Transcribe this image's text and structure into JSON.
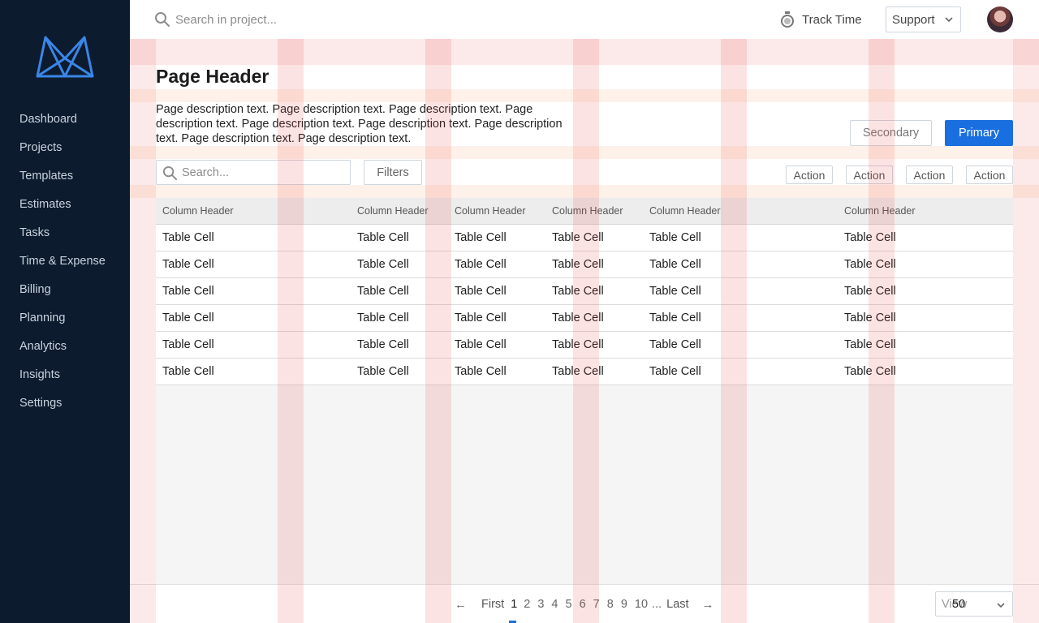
{
  "sidebar": {
    "items": [
      {
        "label": "Dashboard"
      },
      {
        "label": "Projects"
      },
      {
        "label": "Templates"
      },
      {
        "label": "Estimates"
      },
      {
        "label": "Tasks"
      },
      {
        "label": "Time & Expense"
      },
      {
        "label": "Billing"
      },
      {
        "label": "Planning"
      },
      {
        "label": "Analytics"
      },
      {
        "label": "Insights"
      },
      {
        "label": "Settings"
      }
    ]
  },
  "topbar": {
    "search_placeholder": "Search in project...",
    "track_time_label": "Track Time",
    "support_label": "Support"
  },
  "page": {
    "title": "Page Header",
    "description": "Page description text. Page description text. Page description text. Page description text. Page description text. Page description text. Page description text. Page description text. Page description text.",
    "secondary_label": "Secondary",
    "primary_label": "Primary"
  },
  "toolbar": {
    "search_placeholder": "Search...",
    "filters_label": "Filters",
    "actions": [
      "Action",
      "Action",
      "Action",
      "Action"
    ]
  },
  "table": {
    "headers": [
      "Column Header",
      "Column Header",
      "Column Header",
      "Column Header",
      "Column Header",
      "Column Header"
    ],
    "rows": [
      [
        "Table Cell",
        "Table Cell",
        "Table Cell",
        "Table Cell",
        "Table Cell",
        "Table Cell"
      ],
      [
        "Table Cell",
        "Table Cell",
        "Table Cell",
        "Table Cell",
        "Table Cell",
        "Table Cell"
      ],
      [
        "Table Cell",
        "Table Cell",
        "Table Cell",
        "Table Cell",
        "Table Cell",
        "Table Cell"
      ],
      [
        "Table Cell",
        "Table Cell",
        "Table Cell",
        "Table Cell",
        "Table Cell",
        "Table Cell"
      ],
      [
        "Table Cell",
        "Table Cell",
        "Table Cell",
        "Table Cell",
        "Table Cell",
        "Table Cell"
      ],
      [
        "Table Cell",
        "Table Cell",
        "Table Cell",
        "Table Cell",
        "Table Cell",
        "Table Cell"
      ]
    ]
  },
  "pagination": {
    "first_label": "First",
    "last_label": "Last",
    "pages": [
      "1",
      "2",
      "3",
      "4",
      "5",
      "6",
      "7",
      "8",
      "9",
      "10"
    ],
    "ellipsis": "...",
    "current_page": "1",
    "view_label": "View",
    "view_value": "50"
  },
  "colors": {
    "sidebar_bg": "#0c1b2e",
    "accent": "#1a6fe0",
    "grid_overlay": "#e84646"
  }
}
